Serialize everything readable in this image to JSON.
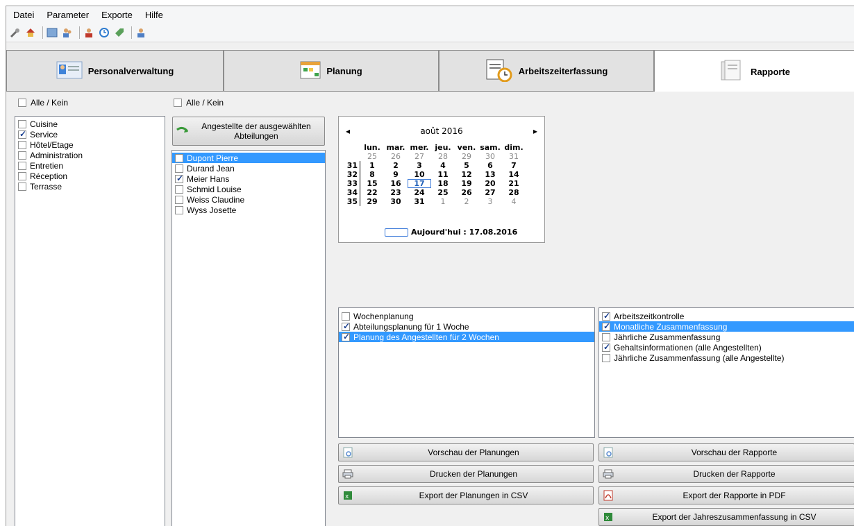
{
  "menu": [
    "Datei",
    "Parameter",
    "Exporte",
    "Hilfe"
  ],
  "tabs": {
    "personal": "Personalverwaltung",
    "planung": "Planung",
    "arbeitszeit": "Arbeitszeiterfassung",
    "rapporte": "Rapporte"
  },
  "departments": {
    "all_label": "Alle / Kein",
    "items": [
      {
        "label": "Cuisine",
        "checked": false
      },
      {
        "label": "Service",
        "checked": true
      },
      {
        "label": "Hôtel/Etage",
        "checked": false
      },
      {
        "label": "Administration",
        "checked": false
      },
      {
        "label": "Entretien",
        "checked": false
      },
      {
        "label": "Réception",
        "checked": false
      },
      {
        "label": "Terrasse",
        "checked": false
      }
    ]
  },
  "employees": {
    "all_label": "Alle / Kein",
    "load_button": "Angestellte der ausgewählten\nAbteilungen",
    "items": [
      {
        "label": "Dupont Pierre",
        "checked": false,
        "selected": true
      },
      {
        "label": "Durand Jean",
        "checked": false
      },
      {
        "label": "Meier Hans",
        "checked": true
      },
      {
        "label": "Schmid Louise",
        "checked": false
      },
      {
        "label": "Weiss Claudine",
        "checked": false
      },
      {
        "label": "Wyss Josette",
        "checked": false
      }
    ]
  },
  "calendar": {
    "month_title": "août 2016",
    "prev": "◂",
    "next": "▸",
    "weekdays": [
      "lun.",
      "mar.",
      "mer.",
      "jeu.",
      "ven.",
      "sam.",
      "dim."
    ],
    "weeks": [
      {
        "wk": "",
        "days": [
          {
            "d": "25",
            "g": true
          },
          {
            "d": "26",
            "g": true
          },
          {
            "d": "27",
            "g": true
          },
          {
            "d": "28",
            "g": true
          },
          {
            "d": "29",
            "g": true
          },
          {
            "d": "30",
            "g": true
          },
          {
            "d": "31",
            "g": true
          }
        ]
      },
      {
        "wk": "31",
        "days": [
          {
            "d": "1"
          },
          {
            "d": "2"
          },
          {
            "d": "3"
          },
          {
            "d": "4"
          },
          {
            "d": "5"
          },
          {
            "d": "6"
          },
          {
            "d": "7"
          }
        ]
      },
      {
        "wk": "32",
        "days": [
          {
            "d": "8"
          },
          {
            "d": "9"
          },
          {
            "d": "10"
          },
          {
            "d": "11"
          },
          {
            "d": "12"
          },
          {
            "d": "13"
          },
          {
            "d": "14"
          }
        ]
      },
      {
        "wk": "33",
        "days": [
          {
            "d": "15"
          },
          {
            "d": "16"
          },
          {
            "d": "17",
            "today": true
          },
          {
            "d": "18"
          },
          {
            "d": "19"
          },
          {
            "d": "20"
          },
          {
            "d": "21"
          }
        ]
      },
      {
        "wk": "34",
        "days": [
          {
            "d": "22"
          },
          {
            "d": "23"
          },
          {
            "d": "24"
          },
          {
            "d": "25"
          },
          {
            "d": "26"
          },
          {
            "d": "27"
          },
          {
            "d": "28"
          }
        ]
      },
      {
        "wk": "35",
        "days": [
          {
            "d": "29"
          },
          {
            "d": "30"
          },
          {
            "d": "31"
          },
          {
            "d": "1",
            "g": true
          },
          {
            "d": "2",
            "g": true
          },
          {
            "d": "3",
            "g": true
          },
          {
            "d": "4",
            "g": true
          }
        ]
      }
    ],
    "today_label": "Aujourd'hui : 17.08.2016"
  },
  "planning_reports": [
    {
      "label": "Wochenplanung",
      "checked": false
    },
    {
      "label": "Abteilungsplanung für 1 Woche",
      "checked": true
    },
    {
      "label": "Planung des Angestellten für 2 Wochen",
      "checked": true,
      "selected": true
    }
  ],
  "time_reports": [
    {
      "label": "Arbeitszeitkontrolle",
      "checked": true
    },
    {
      "label": "Monatliche Zusammenfassung",
      "checked": true,
      "selected": true
    },
    {
      "label": "Jährliche Zusammenfassung",
      "checked": false
    },
    {
      "label": "Gehaltsinformationen (alle Angestellten)",
      "checked": true
    },
    {
      "label": "Jährliche Zusammenfassung (alle Angestellte)",
      "checked": false
    }
  ],
  "buttons": {
    "preview_planning": "Vorschau der Planungen",
    "print_planning": "Drucken der Planungen",
    "export_planning_csv": "Export der Planungen in CSV",
    "preview_reports": "Vorschau der Rapporte",
    "print_reports": "Drucken der Rapporte",
    "export_reports_pdf": "Export der Rapporte in PDF",
    "export_annual_csv": "Export der Jahreszusammenfassung in CSV"
  },
  "colors": {
    "selection": "#3399ff",
    "check": "#1a3f8f",
    "today_outline": "#3d7bd9"
  }
}
